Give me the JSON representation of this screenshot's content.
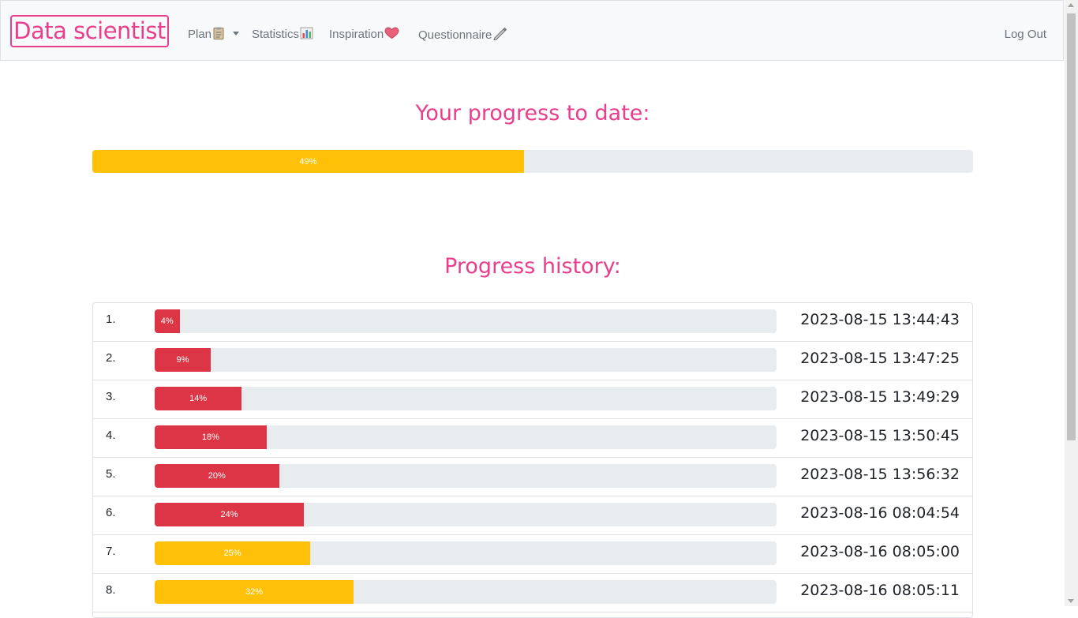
{
  "navbar": {
    "brand": "Data scientist",
    "items": [
      {
        "label": "Plan",
        "icon": "clipboard-icon",
        "dropdown": true
      },
      {
        "label": "Statistics",
        "icon": "bar-chart-icon"
      },
      {
        "label": "Inspiration",
        "icon": "heart-icon"
      },
      {
        "label": "Questionnaire",
        "icon": "pencil-icon"
      }
    ],
    "logout": "Log Out"
  },
  "current": {
    "heading": "Your progress to date:",
    "percent": 49,
    "label": "49%",
    "color": "#ffc107"
  },
  "history": {
    "heading": "Progress history:",
    "entries": [
      {
        "index": "1.",
        "percent": 4,
        "label": "4%",
        "status": "red",
        "timestamp": "2023-08-15 13:44:43"
      },
      {
        "index": "2.",
        "percent": 9,
        "label": "9%",
        "status": "red",
        "timestamp": "2023-08-15 13:47:25"
      },
      {
        "index": "3.",
        "percent": 14,
        "label": "14%",
        "status": "red",
        "timestamp": "2023-08-15 13:49:29"
      },
      {
        "index": "4.",
        "percent": 18,
        "label": "18%",
        "status": "red",
        "timestamp": "2023-08-15 13:50:45"
      },
      {
        "index": "5.",
        "percent": 20,
        "label": "20%",
        "status": "red",
        "timestamp": "2023-08-15 13:56:32"
      },
      {
        "index": "6.",
        "percent": 24,
        "label": "24%",
        "status": "red",
        "timestamp": "2023-08-16 08:04:54"
      },
      {
        "index": "7.",
        "percent": 25,
        "label": "25%",
        "status": "yellow",
        "timestamp": "2023-08-16 08:05:00"
      },
      {
        "index": "8.",
        "percent": 32,
        "label": "32%",
        "status": "yellow",
        "timestamp": "2023-08-16 08:05:11"
      }
    ]
  },
  "colors": {
    "accent": "#e83e8c",
    "red": "#dc3545",
    "yellow": "#ffc107",
    "track": "#e9ecef"
  }
}
